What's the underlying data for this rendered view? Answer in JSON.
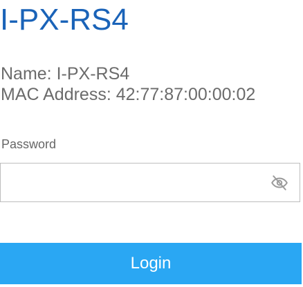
{
  "device": {
    "title": "I-PX-RS4",
    "name_line": "Name: I-PX-RS4",
    "mac_line": "MAC Address: 42:77:87:00:00:02"
  },
  "login_form": {
    "password_label": "Password",
    "password_value": "",
    "toggle_icon": "eye-slash-icon",
    "login_label": "Login"
  },
  "colors": {
    "title": "#1a63b8",
    "info_text": "#6b6b6b",
    "button_bg": "#2aa7f3",
    "button_text": "#ffffff",
    "field_border": "#bdbdbd"
  }
}
